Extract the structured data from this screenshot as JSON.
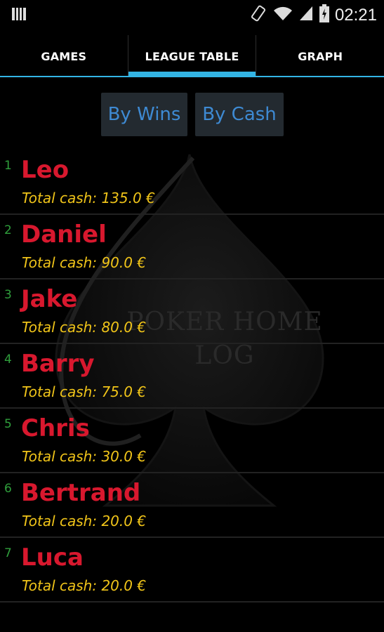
{
  "status_bar": {
    "time": "02:21"
  },
  "tabs": [
    {
      "label": "GAMES",
      "active": false
    },
    {
      "label": "LEAGUE TABLE",
      "active": true
    },
    {
      "label": "GRAPH",
      "active": false
    }
  ],
  "sort_buttons": {
    "by_wins": "By Wins",
    "by_cash": "By Cash"
  },
  "watermark": {
    "line1": "POKER HOME",
    "line2": "LOG"
  },
  "cash_prefix": "Total cash:",
  "players": [
    {
      "rank": "1",
      "name": "Leo",
      "cash": "135.0 €"
    },
    {
      "rank": "2",
      "name": "Daniel",
      "cash": "90.0 €"
    },
    {
      "rank": "3",
      "name": "Jake",
      "cash": "80.0 €"
    },
    {
      "rank": "4",
      "name": "Barry",
      "cash": "75.0 €"
    },
    {
      "rank": "5",
      "name": "Chris",
      "cash": "30.0 €"
    },
    {
      "rank": "6",
      "name": "Bertrand",
      "cash": "20.0 €"
    },
    {
      "rank": "7",
      "name": "Luca",
      "cash": "20.0 €"
    }
  ],
  "colors": {
    "accent": "#33b5e5",
    "rank": "#2f9f3c",
    "name": "#d8182e",
    "cash": "#f0c419",
    "button_text": "#3e8ad3"
  }
}
